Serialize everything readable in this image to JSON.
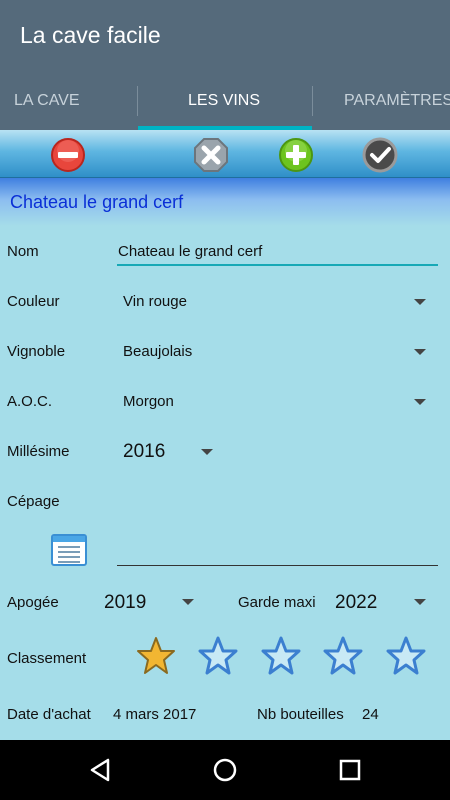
{
  "app": {
    "title": "La cave facile"
  },
  "tabs": [
    {
      "label": "LA CAVE",
      "active": false
    },
    {
      "label": "LES VINS",
      "active": true
    },
    {
      "label": "PARAMÈTRES",
      "active": false
    }
  ],
  "toolbar": {
    "buttons": [
      {
        "icon": "minus-circle-icon",
        "color": "#e8463c"
      },
      {
        "icon": "close-octagon-icon",
        "color": "#9aa4ac"
      },
      {
        "icon": "plus-circle-icon",
        "color": "#6cc41e"
      },
      {
        "icon": "check-circle-icon",
        "color": "#4a4a4a"
      }
    ]
  },
  "wine": {
    "header_name": "Chateau le grand cerf",
    "fields": {
      "nom": {
        "label": "Nom",
        "value": "Chateau le grand cerf"
      },
      "couleur": {
        "label": "Couleur",
        "value": "Vin rouge"
      },
      "vignoble": {
        "label": "Vignoble",
        "value": "Beaujolais"
      },
      "aoc": {
        "label": "A.O.C.",
        "value": "Morgon"
      },
      "millesime": {
        "label": "Millésime",
        "value": "2016"
      },
      "cepage": {
        "label": "Cépage",
        "value": ""
      },
      "apogee": {
        "label": "Apogée",
        "value": "2019"
      },
      "garde_maxi": {
        "label": "Garde maxi",
        "value": "2022"
      },
      "classement": {
        "label": "Classement",
        "rating": 1,
        "max": 5
      },
      "date_achat": {
        "label": "Date d'achat",
        "value": "4 mars 2017"
      },
      "nb_bouteilles": {
        "label": "Nb bouteilles",
        "value": "24"
      }
    }
  },
  "colors": {
    "appbar": "#556a7b",
    "accent": "#00b3c4",
    "background": "#a5dde9",
    "header_text": "#0a2fd6",
    "star_filled": "#f2b632",
    "star_empty": "#3b7fd0"
  },
  "navbar": {
    "buttons": [
      "back-icon",
      "home-icon",
      "recents-icon"
    ]
  }
}
